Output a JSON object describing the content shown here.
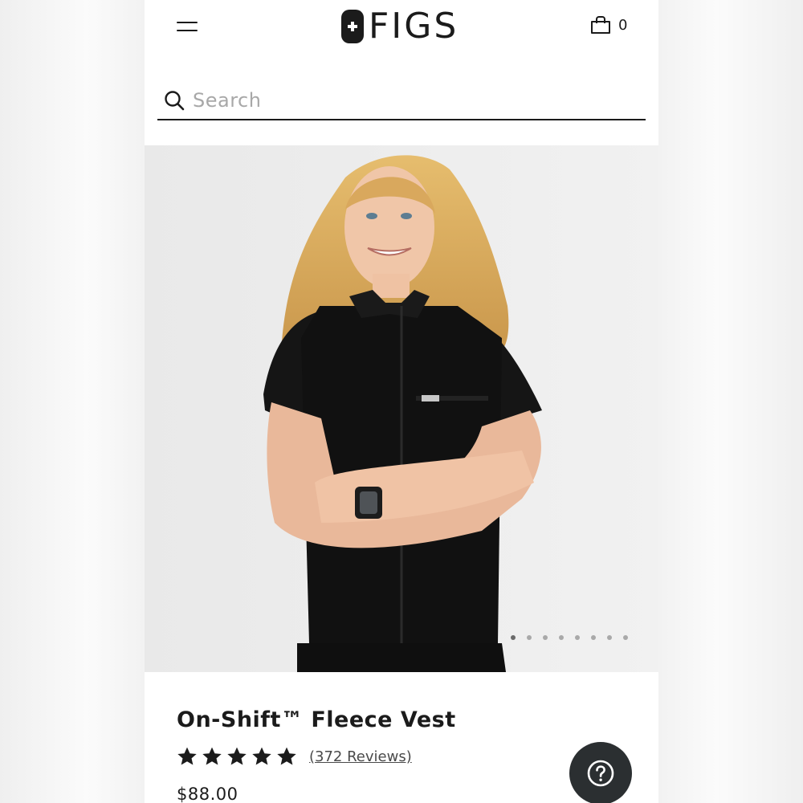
{
  "header": {
    "brand": "FIGS",
    "cart_count": "0"
  },
  "search": {
    "placeholder": "Search"
  },
  "gallery": {
    "image_alt": "Model wearing black On-Shift Fleece Vest",
    "dot_count": 8,
    "active_dot": 0
  },
  "product": {
    "title": "On-Shift™ Fleece Vest",
    "rating": 5,
    "reviews_label": "(372 Reviews)",
    "price": "$88.00"
  },
  "colors": {
    "text": "#1b1b1b",
    "help_button": "#2b2f31",
    "photo_bg": "#ededed"
  },
  "icons": [
    "menu-icon",
    "figs-logo-icon",
    "shopping-bag-icon",
    "search-icon",
    "star-icon",
    "help-icon"
  ]
}
